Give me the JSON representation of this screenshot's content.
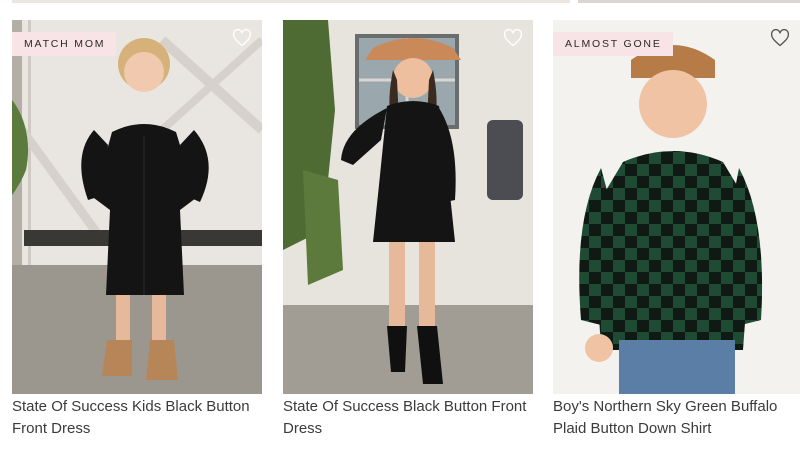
{
  "products": [
    {
      "badge": "MATCH MOM",
      "title": "State Of Success Kids Black Button Front Dress",
      "photo_colors": {
        "dress": "#141414",
        "boots": "#b68658",
        "wall": "#e9e6e1"
      }
    },
    {
      "badge": "",
      "title": "State Of Success Black Button Front Dress",
      "photo_colors": {
        "dress": "#141414",
        "hat": "#c98958",
        "wall": "#e7e4de"
      }
    },
    {
      "badge": "ALMOST GONE",
      "title": "Boy's Northern Sky Green Buffalo Plaid Button Down Shirt",
      "photo_colors": {
        "shirt": "#1f4a34",
        "jeans": "#5a7ea6",
        "background": "#f4f2ef"
      }
    }
  ],
  "icons": {
    "wishlist": "heart-outline-icon"
  },
  "colors": {
    "badge_bg": "#f8e3e6",
    "title_text": "#3b3b3b"
  }
}
